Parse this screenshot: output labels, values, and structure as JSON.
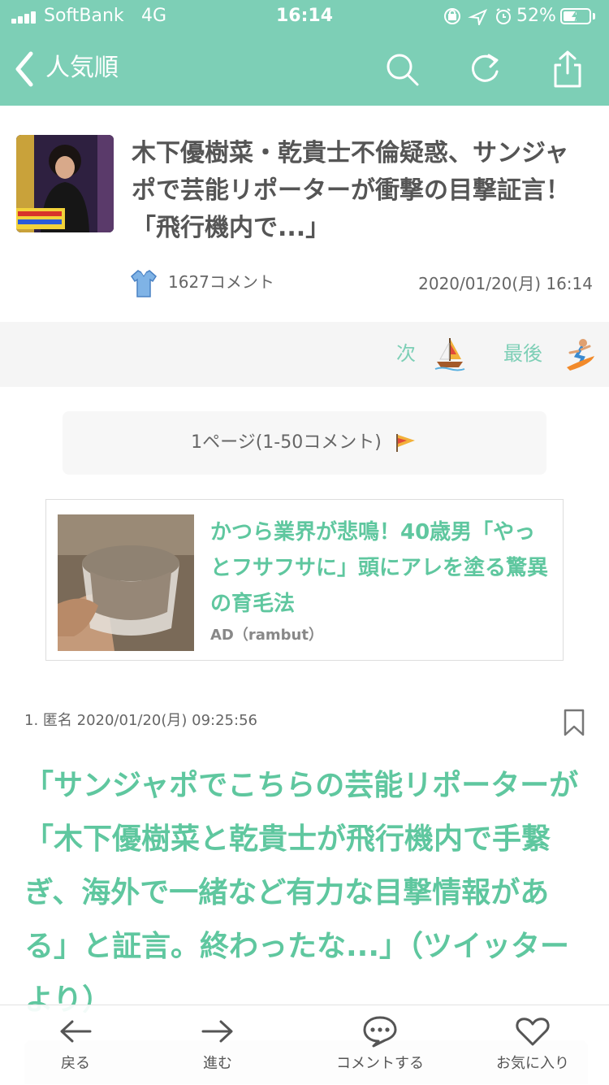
{
  "status_bar": {
    "carrier": "SoftBank",
    "network": "4G",
    "time": "16:14",
    "battery_percent": "52%",
    "battery_level": 0.52,
    "icons": [
      "lock-rotation-icon",
      "location-arrow-icon",
      "alarm-icon"
    ]
  },
  "nav": {
    "back_label": "人気順",
    "buttons": [
      "search-icon",
      "refresh-icon",
      "share-icon"
    ]
  },
  "article": {
    "title": "木下優樹菜・乾貴士不倫疑惑、サンジャポで芸能リポーターが衝撃の目撃証言！「飛行機内で...」",
    "comment_count": "1627コメント",
    "timestamp": "2020/01/20(月) 16:14"
  },
  "pager": {
    "next_label": "次",
    "last_label": "最後"
  },
  "page_indicator": "1ページ(1-50コメント)",
  "ad": {
    "title": "かつら業界が悲鳴！40歳男「やっとフサフサに」頭にアレを塗る驚異の育毛法",
    "source": "AD（rambut）"
  },
  "comment": {
    "meta": "1. 匿名 2020/01/20(月) 09:25:56",
    "body": "「サンジャポでこちらの芸能リポーターが「木下優樹菜と乾貴士が飛行機内で手繋ぎ、海外で一緒など有力な目撃情報がある」と証言。終わったな...」（ツイッターより）"
  },
  "tabbar": {
    "back": "戻る",
    "forward": "進む",
    "comment": "コメントする",
    "favorite": "お気に入り"
  },
  "colors": {
    "accent": "#7dcfb6",
    "accent_text": "#5fc79f",
    "text": "#555555"
  }
}
